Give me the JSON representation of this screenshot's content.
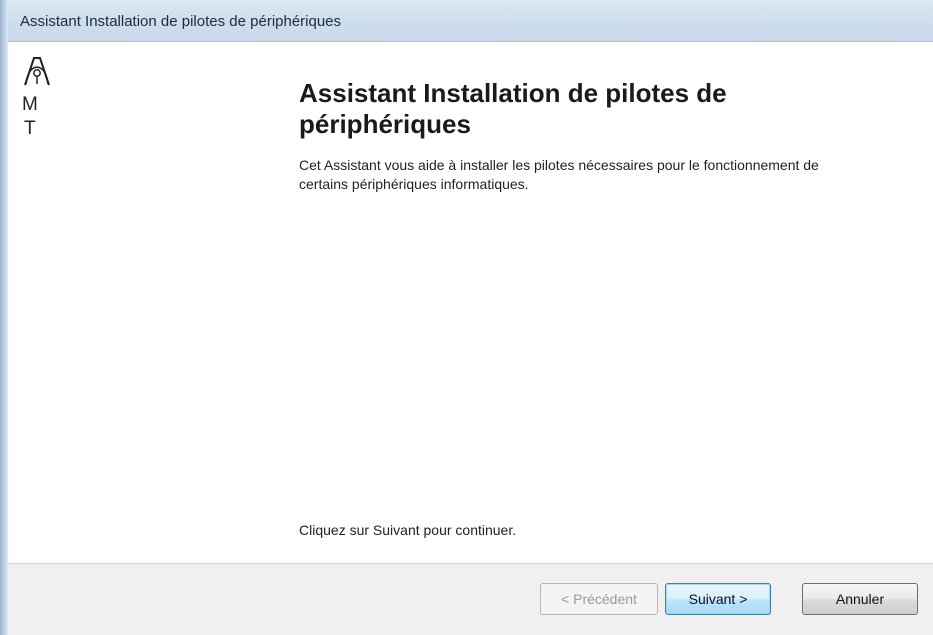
{
  "window": {
    "title": "Assistant Installation de pilotes de périphériques"
  },
  "logo": {
    "letter_m": "M",
    "letter_t": "T"
  },
  "main": {
    "heading": "Assistant Installation de pilotes de périphériques",
    "description": "Cet Assistant vous aide à installer les pilotes nécessaires pour le fonctionnement de certains périphériques informatiques.",
    "continue_text": "Cliquez sur Suivant pour continuer."
  },
  "footer": {
    "prev_label": "< Précédent",
    "next_label": "Suivant >",
    "cancel_label": "Annuler"
  },
  "colors": {
    "titlebar": "#cfdeed",
    "footer": "#f0f0f0",
    "default_button_border": "#3c7fb1"
  },
  "icons": [
    "logo-icon"
  ]
}
